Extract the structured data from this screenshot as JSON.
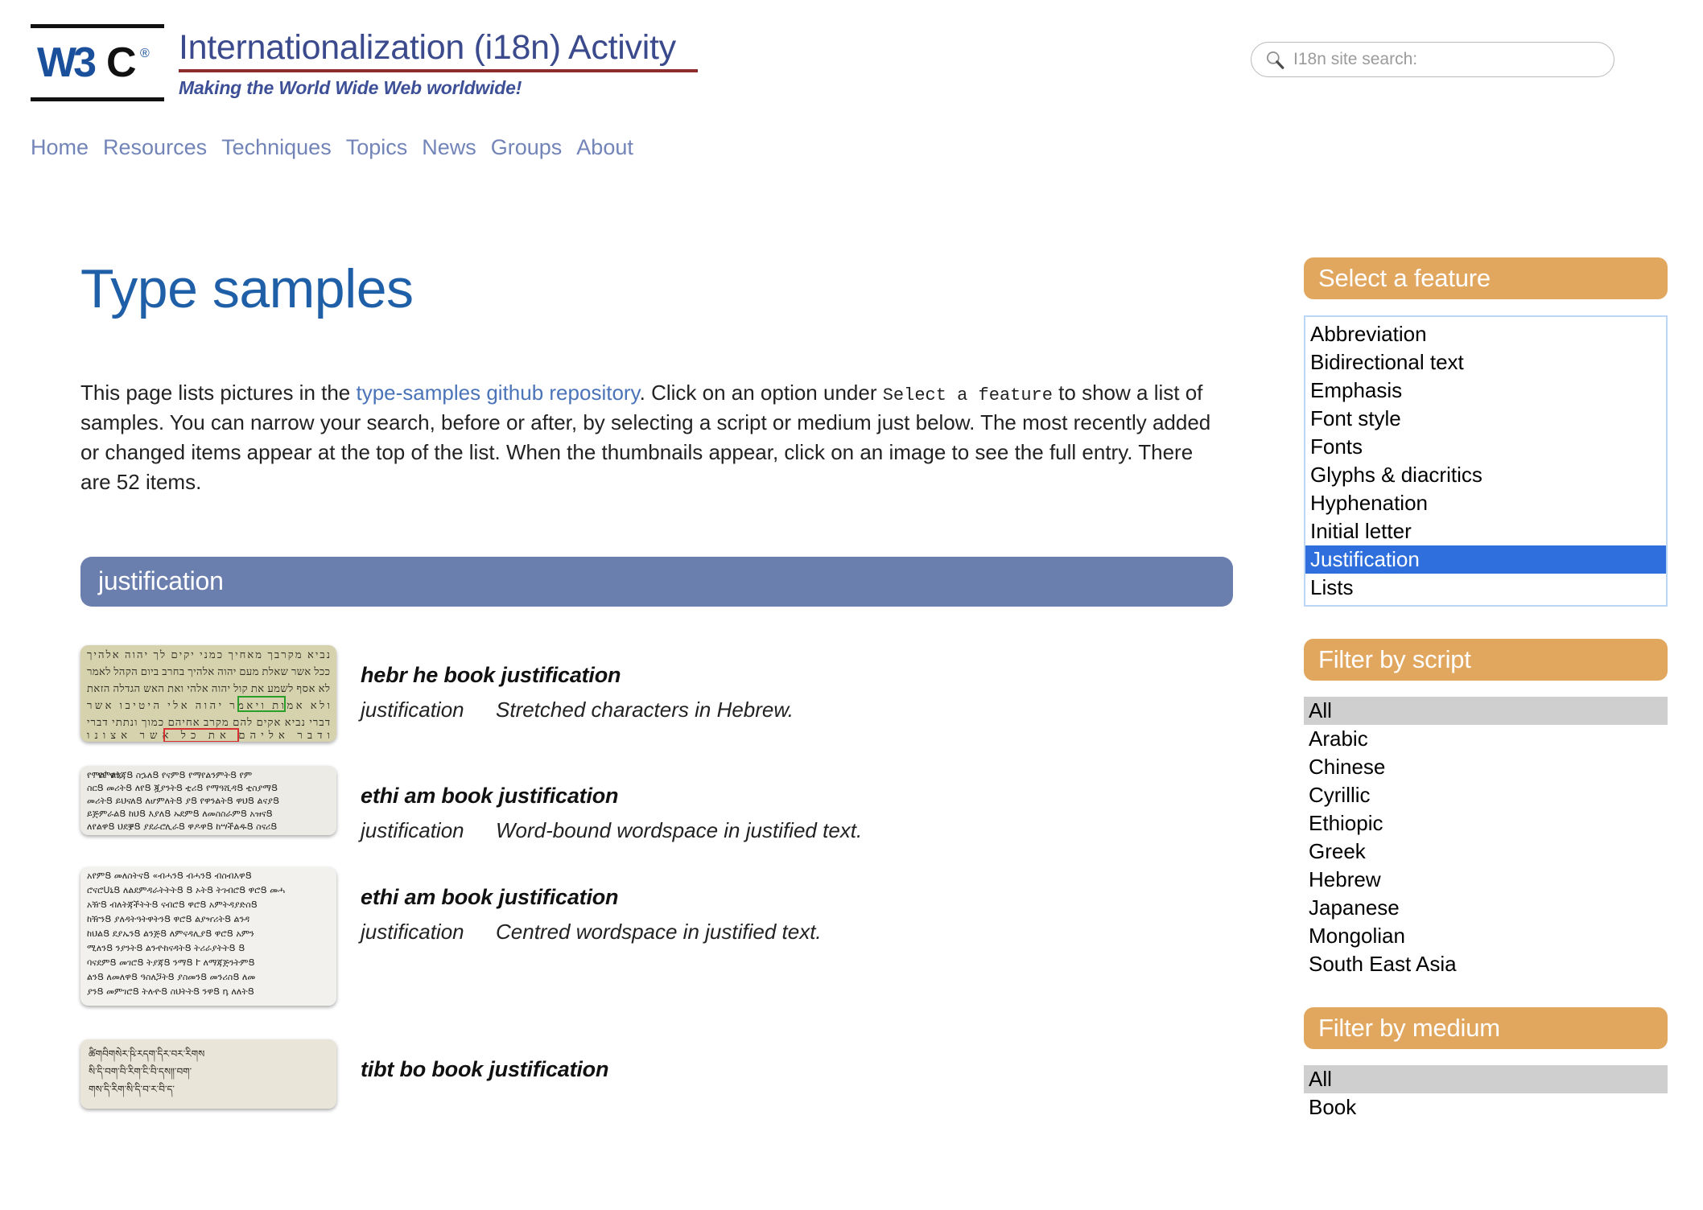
{
  "header": {
    "logo_alt": "W3C",
    "site_title": "Internationalization (i18n) Activity",
    "tagline": "Making the World Wide Web worldwide!"
  },
  "search": {
    "placeholder": "I18n site search:",
    "value": ""
  },
  "nav": {
    "items": [
      {
        "label": "Home"
      },
      {
        "label": "Resources"
      },
      {
        "label": "Techniques"
      },
      {
        "label": "Topics"
      },
      {
        "label": "News"
      },
      {
        "label": "Groups"
      },
      {
        "label": "About"
      }
    ]
  },
  "main": {
    "page_title": "Type samples",
    "intro": {
      "part1": "This page lists pictures in the ",
      "link": "type-samples github repository",
      "part2": ". Click on an option under ",
      "code": "Select a feature",
      "part3": " to show a list of samples. You can narrow your search, before or after, by selecting a script or medium just below. The most recently added or changed items appear at the top of the list. When the thumbnails appear, click on an image to see the full entry. There are 52 items."
    },
    "section_label": "justification",
    "samples": [
      {
        "title": "hebr he book justification",
        "feature": "justification",
        "description": "Stretched characters in Hebrew.",
        "thumb_script": "hebrew"
      },
      {
        "title": "ethi am book justification",
        "feature": "justification",
        "description": "Word-bound wordspace in justified text.",
        "thumb_script": "ethiopic"
      },
      {
        "title": "ethi am book justification",
        "feature": "justification",
        "description": "Centred wordspace in justified text.",
        "thumb_script": "ethiopic-tall"
      },
      {
        "title": "tibt bo book justification",
        "feature": "",
        "description": "",
        "thumb_script": "tibetan"
      }
    ]
  },
  "sidebar": {
    "feature_panel": {
      "heading": "Select a feature",
      "options": [
        {
          "label": "Abbreviation",
          "selected": false
        },
        {
          "label": "Bidirectional text",
          "selected": false
        },
        {
          "label": "Emphasis",
          "selected": false
        },
        {
          "label": "Font style",
          "selected": false
        },
        {
          "label": "Fonts",
          "selected": false
        },
        {
          "label": "Glyphs & diacritics",
          "selected": false
        },
        {
          "label": "Hyphenation",
          "selected": false
        },
        {
          "label": "Initial letter",
          "selected": false
        },
        {
          "label": "Justification",
          "selected": true
        },
        {
          "label": "Lists",
          "selected": false
        }
      ]
    },
    "script_panel": {
      "heading": "Filter by script",
      "options": [
        {
          "label": "All",
          "highlighted": true
        },
        {
          "label": "Arabic",
          "highlighted": false
        },
        {
          "label": "Chinese",
          "highlighted": false
        },
        {
          "label": "Cyrillic",
          "highlighted": false
        },
        {
          "label": "Ethiopic",
          "highlighted": false
        },
        {
          "label": "Greek",
          "highlighted": false
        },
        {
          "label": "Hebrew",
          "highlighted": false
        },
        {
          "label": "Japanese",
          "highlighted": false
        },
        {
          "label": "Mongolian",
          "highlighted": false
        },
        {
          "label": "South East Asia",
          "highlighted": false
        }
      ]
    },
    "medium_panel": {
      "heading": "Filter by medium",
      "options": [
        {
          "label": "All",
          "highlighted": true
        },
        {
          "label": "Book",
          "highlighted": false
        }
      ]
    }
  },
  "colors": {
    "accent_orange": "#e2a75f",
    "banner_blue": "#6b7fae",
    "selection_blue": "#2f6fdd",
    "title_blue": "#1f5fa8",
    "nav_blue": "#7284b8",
    "rule_red": "#8c2c2c",
    "highlight_grey": "#cfcfcf"
  }
}
